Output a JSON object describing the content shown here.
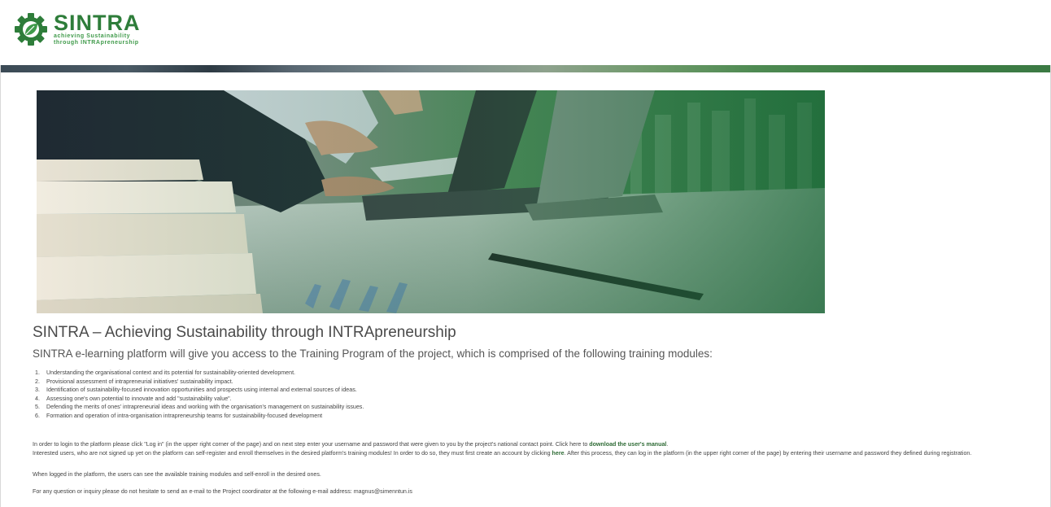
{
  "brand": {
    "title": "SINTRA",
    "tagline_line1": "achieving Sustainability",
    "tagline_line2": "through INTRApreneurship",
    "primary_color": "#2e7d3a",
    "accent_color": "#3f9a4a",
    "logo_icon": "gear-leaf-icon"
  },
  "main": {
    "title": "SINTRA – Achieving Sustainability through INTRApreneurship",
    "subtitle": "SINTRA e-learning platform will give you access to the Training Program of the project, which is comprised of the following training modules:",
    "modules": [
      {
        "num": "1.",
        "text": "Understanding the organisational context and its potential for sustainability-oriented development."
      },
      {
        "num": "2.",
        "text": "Provisional assessment of intrapreneurial initiatives' sustainability impact."
      },
      {
        "num": "3.",
        "text": "Identification of sustainability-focused innovation opportunities and prospects using internal and external sources of ideas."
      },
      {
        "num": "4.",
        "text": "Assessing one's own potential to innovate and add \"sustainability value\"."
      },
      {
        "num": "5.",
        "text": "Defending the merits of ones' intrapreneurial ideas and working with the organisation's management on sustainability issues."
      },
      {
        "num": "6.",
        "text": "Formation and operation of intra-organisation intrapreneurship teams for sustainability-focused development"
      }
    ],
    "p1_text": "In order to login to the platform please click \"Log in\" (in the upper right corner of the page) and on next step enter your username and password that were given to you by the project's national contact point. Click here to ",
    "p1_link": "download the user's manual",
    "p1_end": ".",
    "p2_text": "Interested users, who are not signed up yet on the platform can self-register and enroll themselves in the desired platform's training modules! In order to do so, they must first create an account by clicking ",
    "p2_link": "here",
    "p2_end": ". After this process, they can log in the platform (in the upper right corner of the page) by entering their username and password they defined during registration.",
    "p3_text": "When logged in the platform, the users can see the available training modules and self-enroll in the desired ones.",
    "p4_text": "For any question or inquiry please do not hesitate to send an e-mail to the Project coordinator at the following e-mail address: magnus@simenntun.is"
  }
}
